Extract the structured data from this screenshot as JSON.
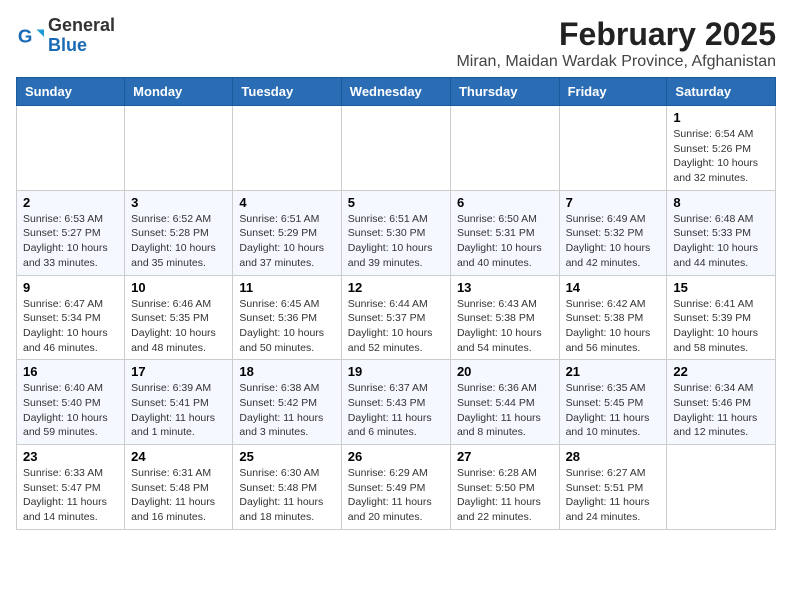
{
  "logo": {
    "general": "General",
    "blue": "Blue"
  },
  "header": {
    "title": "February 2025",
    "subtitle": "Miran, Maidan Wardak Province, Afghanistan"
  },
  "weekdays": [
    "Sunday",
    "Monday",
    "Tuesday",
    "Wednesday",
    "Thursday",
    "Friday",
    "Saturday"
  ],
  "weeks": [
    [
      {
        "day": "",
        "info": ""
      },
      {
        "day": "",
        "info": ""
      },
      {
        "day": "",
        "info": ""
      },
      {
        "day": "",
        "info": ""
      },
      {
        "day": "",
        "info": ""
      },
      {
        "day": "",
        "info": ""
      },
      {
        "day": "1",
        "info": "Sunrise: 6:54 AM\nSunset: 5:26 PM\nDaylight: 10 hours\nand 32 minutes."
      }
    ],
    [
      {
        "day": "2",
        "info": "Sunrise: 6:53 AM\nSunset: 5:27 PM\nDaylight: 10 hours\nand 33 minutes."
      },
      {
        "day": "3",
        "info": "Sunrise: 6:52 AM\nSunset: 5:28 PM\nDaylight: 10 hours\nand 35 minutes."
      },
      {
        "day": "4",
        "info": "Sunrise: 6:51 AM\nSunset: 5:29 PM\nDaylight: 10 hours\nand 37 minutes."
      },
      {
        "day": "5",
        "info": "Sunrise: 6:51 AM\nSunset: 5:30 PM\nDaylight: 10 hours\nand 39 minutes."
      },
      {
        "day": "6",
        "info": "Sunrise: 6:50 AM\nSunset: 5:31 PM\nDaylight: 10 hours\nand 40 minutes."
      },
      {
        "day": "7",
        "info": "Sunrise: 6:49 AM\nSunset: 5:32 PM\nDaylight: 10 hours\nand 42 minutes."
      },
      {
        "day": "8",
        "info": "Sunrise: 6:48 AM\nSunset: 5:33 PM\nDaylight: 10 hours\nand 44 minutes."
      }
    ],
    [
      {
        "day": "9",
        "info": "Sunrise: 6:47 AM\nSunset: 5:34 PM\nDaylight: 10 hours\nand 46 minutes."
      },
      {
        "day": "10",
        "info": "Sunrise: 6:46 AM\nSunset: 5:35 PM\nDaylight: 10 hours\nand 48 minutes."
      },
      {
        "day": "11",
        "info": "Sunrise: 6:45 AM\nSunset: 5:36 PM\nDaylight: 10 hours\nand 50 minutes."
      },
      {
        "day": "12",
        "info": "Sunrise: 6:44 AM\nSunset: 5:37 PM\nDaylight: 10 hours\nand 52 minutes."
      },
      {
        "day": "13",
        "info": "Sunrise: 6:43 AM\nSunset: 5:38 PM\nDaylight: 10 hours\nand 54 minutes."
      },
      {
        "day": "14",
        "info": "Sunrise: 6:42 AM\nSunset: 5:38 PM\nDaylight: 10 hours\nand 56 minutes."
      },
      {
        "day": "15",
        "info": "Sunrise: 6:41 AM\nSunset: 5:39 PM\nDaylight: 10 hours\nand 58 minutes."
      }
    ],
    [
      {
        "day": "16",
        "info": "Sunrise: 6:40 AM\nSunset: 5:40 PM\nDaylight: 10 hours\nand 59 minutes."
      },
      {
        "day": "17",
        "info": "Sunrise: 6:39 AM\nSunset: 5:41 PM\nDaylight: 11 hours\nand 1 minute."
      },
      {
        "day": "18",
        "info": "Sunrise: 6:38 AM\nSunset: 5:42 PM\nDaylight: 11 hours\nand 3 minutes."
      },
      {
        "day": "19",
        "info": "Sunrise: 6:37 AM\nSunset: 5:43 PM\nDaylight: 11 hours\nand 6 minutes."
      },
      {
        "day": "20",
        "info": "Sunrise: 6:36 AM\nSunset: 5:44 PM\nDaylight: 11 hours\nand 8 minutes."
      },
      {
        "day": "21",
        "info": "Sunrise: 6:35 AM\nSunset: 5:45 PM\nDaylight: 11 hours\nand 10 minutes."
      },
      {
        "day": "22",
        "info": "Sunrise: 6:34 AM\nSunset: 5:46 PM\nDaylight: 11 hours\nand 12 minutes."
      }
    ],
    [
      {
        "day": "23",
        "info": "Sunrise: 6:33 AM\nSunset: 5:47 PM\nDaylight: 11 hours\nand 14 minutes."
      },
      {
        "day": "24",
        "info": "Sunrise: 6:31 AM\nSunset: 5:48 PM\nDaylight: 11 hours\nand 16 minutes."
      },
      {
        "day": "25",
        "info": "Sunrise: 6:30 AM\nSunset: 5:48 PM\nDaylight: 11 hours\nand 18 minutes."
      },
      {
        "day": "26",
        "info": "Sunrise: 6:29 AM\nSunset: 5:49 PM\nDaylight: 11 hours\nand 20 minutes."
      },
      {
        "day": "27",
        "info": "Sunrise: 6:28 AM\nSunset: 5:50 PM\nDaylight: 11 hours\nand 22 minutes."
      },
      {
        "day": "28",
        "info": "Sunrise: 6:27 AM\nSunset: 5:51 PM\nDaylight: 11 hours\nand 24 minutes."
      },
      {
        "day": "",
        "info": ""
      }
    ]
  ]
}
